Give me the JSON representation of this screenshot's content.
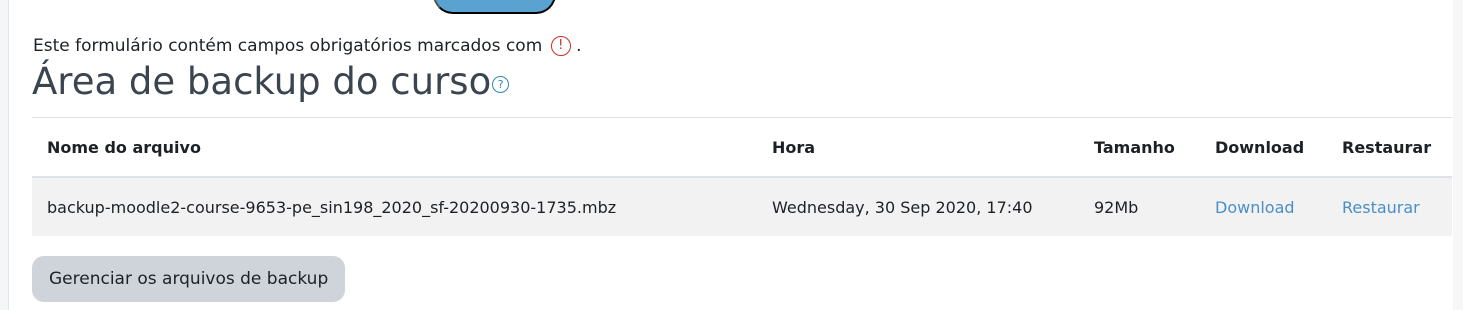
{
  "form": {
    "required_note": "Este formulário contém campos obrigatórios marcados com",
    "required_suffix": ".",
    "required_icon": "exclamation-circle-icon"
  },
  "page": {
    "title": "Área de backup do curso",
    "help_icon": "question-circle-icon"
  },
  "table": {
    "headers": [
      "Nome do arquivo",
      "Hora",
      "Tamanho",
      "Download",
      "Restaurar"
    ],
    "rows": [
      {
        "filename": "backup-moodle2-course-9653-pe_sin198_2020_sf-20200930-1735.mbz",
        "time": "Wednesday, 30 Sep 2020, 17:40",
        "size": "92Mb",
        "download_label": "Download",
        "restore_label": "Restaurar"
      }
    ]
  },
  "actions": {
    "manage_label": "Gerenciar os arquivos de backup"
  },
  "colors": {
    "accent": "#5aa2d0",
    "link": "#4a8fc7",
    "required": "#ca3120",
    "button_bg": "#ced4da"
  }
}
